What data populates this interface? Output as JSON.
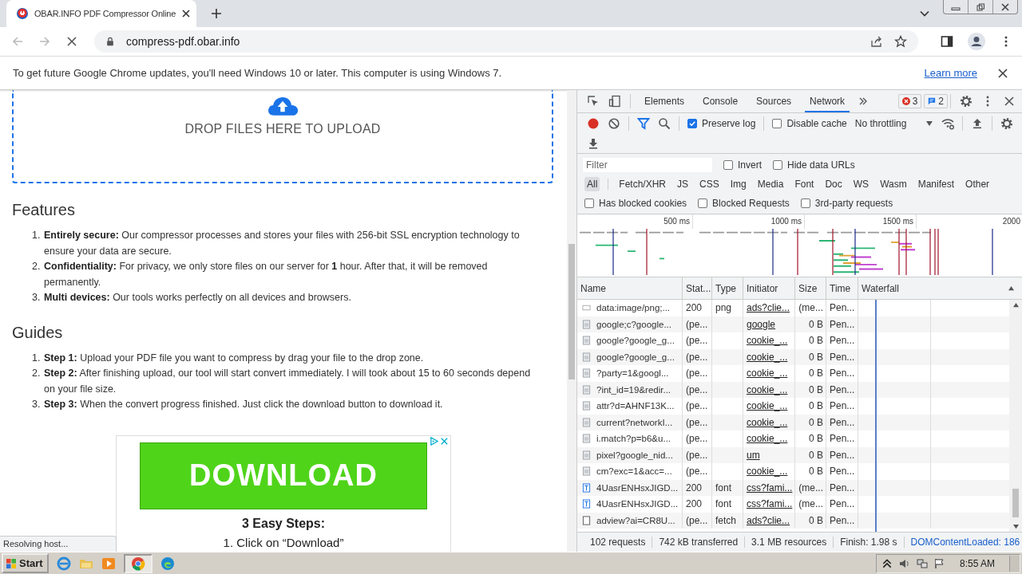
{
  "browser": {
    "tab_title": "OBAR.INFO PDF Compressor Online",
    "url": "compress-pdf.obar.info",
    "infobar": {
      "message": "To get future Google Chrome updates, you'll need Windows 10 or later. This computer is using Windows 7.",
      "link": "Learn more"
    }
  },
  "page": {
    "dropzone": "DROP FILES HERE TO UPLOAD",
    "sections": [
      {
        "heading": "Features",
        "items": [
          {
            "number": "1.",
            "text": "**Entirely secure:** Our compressor processes and stores your files with 256-bit SSL encryption technology to ensure your data are secure."
          },
          {
            "number": "2.",
            "text": "**Confidentiality:** For privacy, we only store files on our server for **1** hour. After that, it will be removed permanently."
          },
          {
            "number": "3.",
            "text": "**Multi devices:** Our tools works perfectly on all devices and browsers."
          }
        ]
      },
      {
        "heading": "Guides",
        "items": [
          {
            "number": "1.",
            "text": "**Step 1:** Upload your PDF file you want to compress by drag your file to the drop zone."
          },
          {
            "number": "2.",
            "text": "**Step 2:** After finishing upload, our tool will start convert immediately. I will took about 15 to 60 seconds depend on your file size."
          },
          {
            "number": "3.",
            "text": "**Step 3:** When the convert progress finished. Just click the download button to download it."
          }
        ]
      }
    ],
    "ad": {
      "button": "DOWNLOAD",
      "title": "3 Easy Steps:",
      "step": "1. Click on “Download”"
    },
    "status": "Resolving host..."
  },
  "devtools": {
    "tabs": [
      {
        "label": "Elements",
        "selected": false
      },
      {
        "label": "Console",
        "selected": false
      },
      {
        "label": "Sources",
        "selected": false
      },
      {
        "label": "Network",
        "selected": true
      }
    ],
    "errors": "3",
    "messages": "2",
    "toolbar_options": [
      {
        "label": "Preserve log",
        "checked": true
      },
      {
        "label": "Disable cache",
        "checked": false
      }
    ],
    "throttling": "No throttling",
    "filter": {
      "placeholder": "Filter"
    },
    "filter_options": [
      {
        "label": "Invert",
        "checked": false
      },
      {
        "label": "Hide data URLs",
        "checked": false
      }
    ],
    "types": [
      {
        "label": "All",
        "selected": true
      },
      {
        "label": "Fetch/XHR",
        "selected": false
      },
      {
        "label": "JS",
        "selected": false
      },
      {
        "label": "CSS",
        "selected": false
      },
      {
        "label": "Img",
        "selected": false
      },
      {
        "label": "Media",
        "selected": false
      },
      {
        "label": "Font",
        "selected": false
      },
      {
        "label": "Doc",
        "selected": false
      },
      {
        "label": "WS",
        "selected": false
      },
      {
        "label": "Wasm",
        "selected": false
      },
      {
        "label": "Manifest",
        "selected": false
      },
      {
        "label": "Other",
        "selected": false
      }
    ],
    "request_options": [
      {
        "label": "Has blocked cookies",
        "checked": false
      },
      {
        "label": "Blocked Requests",
        "checked": false
      },
      {
        "label": "3rd-party requests",
        "checked": false
      }
    ],
    "overview_ticks": [
      "500 ms",
      "1000 ms",
      "1500 ms",
      "2000"
    ],
    "columns": [
      "Name",
      "Stat...",
      "Type",
      "Initiator",
      "Size",
      "Time",
      "Waterfall"
    ],
    "rows": [
      {
        "kind": "image",
        "name": "data:image/png;...",
        "status": "200",
        "type": "png",
        "initiator": "ads?clie...",
        "size": "(me...",
        "time": "Pen..."
      },
      {
        "kind": "document",
        "name": "google;c?google...",
        "status": "(pe...",
        "initiator": "google",
        "size": "0 B",
        "time": "Pen..."
      },
      {
        "kind": "document",
        "name": "google?google_g...",
        "status": "(pe...",
        "initiator": "cookie_...",
        "size": "0 B",
        "time": "Pen..."
      },
      {
        "kind": "document",
        "name": "google?google_g...",
        "status": "(pe...",
        "initiator": "cookie_...",
        "size": "0 B",
        "time": "Pen..."
      },
      {
        "kind": "document",
        "name": "?party=1&googl...",
        "status": "(pe...",
        "initiator": "cookie_...",
        "size": "0 B",
        "time": "Pen..."
      },
      {
        "kind": "document",
        "name": "?int_id=19&redir...",
        "status": "(pe...",
        "initiator": "cookie_...",
        "size": "0 B",
        "time": "Pen..."
      },
      {
        "kind": "document",
        "name": "attr?d=AHNF13K...",
        "status": "(pe...",
        "initiator": "cookie_...",
        "size": "0 B",
        "time": "Pen..."
      },
      {
        "kind": "document",
        "name": "current?networkI...",
        "status": "(pe...",
        "initiator": "cookie_...",
        "size": "0 B",
        "time": "Pen..."
      },
      {
        "kind": "document",
        "name": "i.match?p=b6&u...",
        "status": "(pe...",
        "initiator": "cookie_...",
        "size": "0 B",
        "time": "Pen..."
      },
      {
        "kind": "document",
        "name": "pixel?google_nid...",
        "status": "(pe...",
        "initiator": "um",
        "size": "0 B",
        "time": "Pen..."
      },
      {
        "kind": "document",
        "name": "cm?exc=1&acc=...",
        "status": "(pe...",
        "initiator": "cookie_...",
        "size": "0 B",
        "time": "Pen..."
      },
      {
        "kind": "font",
        "name": "4UasrENHsxJIGD...",
        "status": "200",
        "type": "font",
        "initiator": "css?fami...",
        "size": "(me...",
        "time": "Pen..."
      },
      {
        "kind": "font",
        "name": "4UasrENHsxJIGD...",
        "status": "200",
        "type": "font",
        "initiator": "css?fami...",
        "size": "(me...",
        "time": "Pen..."
      },
      {
        "kind": "fetch",
        "name": "adview?ai=CR8U...",
        "status": "(pe...",
        "type": "fetch",
        "initiator": "ads?clie...",
        "size": "0 B",
        "time": "Pen..."
      }
    ],
    "summary": [
      {
        "text": "102 requests",
        "kind": "plain"
      },
      {
        "text": "742 kB transferred",
        "kind": "plain"
      },
      {
        "text": "3.1 MB resources",
        "kind": "plain"
      },
      {
        "text": "Finish: 1.98 s",
        "kind": "plain"
      },
      {
        "text": "DOMContentLoaded: 186",
        "kind": "event"
      }
    ]
  },
  "taskbar": {
    "start": "Start",
    "time": "8:55 AM"
  }
}
